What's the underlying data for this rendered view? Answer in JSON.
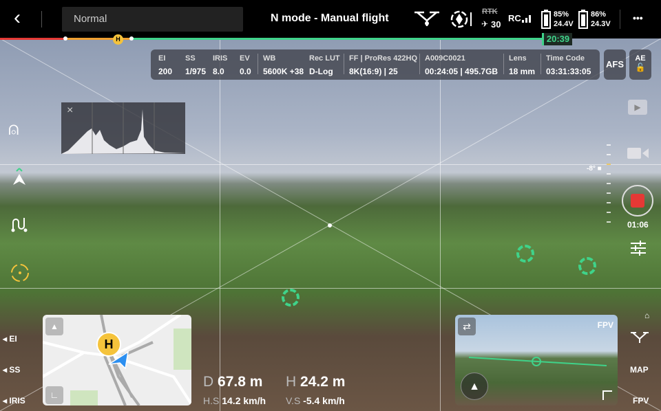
{
  "topbar": {
    "back": "‹",
    "mode": "Normal",
    "title": "N mode - Manual flight",
    "rtk": "RTK",
    "satellites": "30",
    "rc": "RC",
    "battery1": {
      "percent": "85%",
      "voltage": "24.4V"
    },
    "battery2": {
      "percent": "86%",
      "voltage": "24.3V"
    },
    "more": "•••",
    "flight_time": "20:39",
    "home_marker": "H"
  },
  "camera": {
    "cells": [
      {
        "label": "EI",
        "value": "200"
      },
      {
        "label": "SS",
        "value": "1/975"
      },
      {
        "label": "IRIS",
        "value": "8.0"
      },
      {
        "label": "EV",
        "value": "0.0"
      },
      {
        "label": "WB",
        "value": "5600K +38"
      },
      {
        "label": "Rec LUT",
        "value": "D-Log"
      },
      {
        "label": "FF | ProRes 422HQ",
        "value": "8K(16:9) | 25"
      },
      {
        "label": "A009C0021",
        "value": "00:24:05 | 495.7GB"
      },
      {
        "label": "Lens",
        "value": "18 mm"
      },
      {
        "label": "Time Code",
        "value": "03:31:33:05"
      }
    ],
    "afs": "AFS",
    "ae": "AE"
  },
  "gimbal": {
    "angle": "-8°"
  },
  "record": {
    "time": "01:06",
    "color": "#e53935"
  },
  "left": {
    "params": [
      "EI",
      "SS",
      "IRIS"
    ]
  },
  "right": {
    "map": "MAP",
    "fpv": "FPV"
  },
  "fpv": {
    "label": "FPV"
  },
  "map": {
    "home": "H"
  },
  "telemetry": {
    "d_label": "D",
    "d": "67.8 m",
    "h_label": "H",
    "h": "24.2 m",
    "hs_label": "H.S",
    "hs": "14.2 km/h",
    "vs_label": "V.S",
    "vs": "-5.4 km/h"
  },
  "colors": {
    "accent": "#3fd38a",
    "home": "#f5c33b",
    "record": "#e53935"
  }
}
